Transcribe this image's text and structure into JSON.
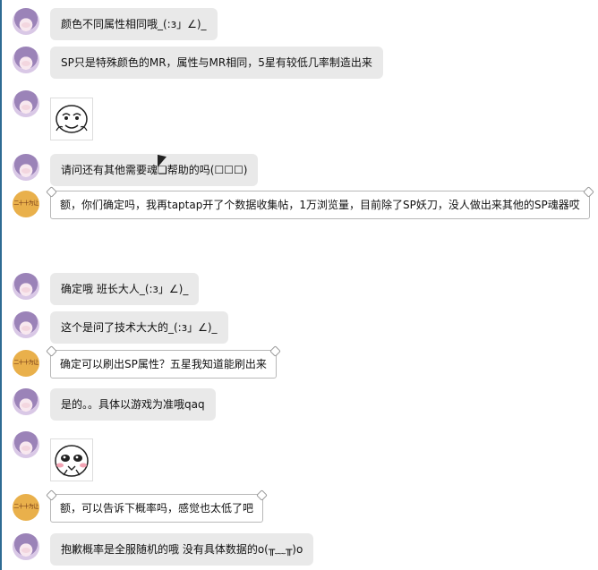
{
  "messages": [
    {
      "text": "颜色不同属性相同哦_(:з」∠)_"
    },
    {
      "text": "SP只是特殊颜色的MR，属性与MR相同，5星有较低几率制造出来"
    },
    {
      "text": "请问还有其他需要魂❏帮助的吗(☐☐☐)"
    },
    {
      "text": "额，你们确定吗，我再taptap开了个数据收集帖，1万浏览量，目前除了SP妖刀，没人做出来其他的SP魂器哎"
    },
    {
      "text": "确定哦 班长大人_(:з」∠)_"
    },
    {
      "text": "这个是问了技术大大的_(:з」∠)_"
    },
    {
      "text": "确定可以刷出SP属性？五星我知道能刷出来"
    },
    {
      "text": "是的。。具体以游戏为准哦qaq"
    },
    {
      "text": "额，可以告诉下概率吗，感觉也太低了吧"
    },
    {
      "text": "抱歉概率是全服随机的哦 没有具体数据的o(╥﹏╥)o"
    }
  ],
  "avatar_badge_text": "二十十为让",
  "colors": {
    "bubble_gray": "#e9e9e9",
    "frame_border": "#b8b8b8",
    "badge_orange": "#e9b04b",
    "left_rule": "#2e6b93"
  }
}
